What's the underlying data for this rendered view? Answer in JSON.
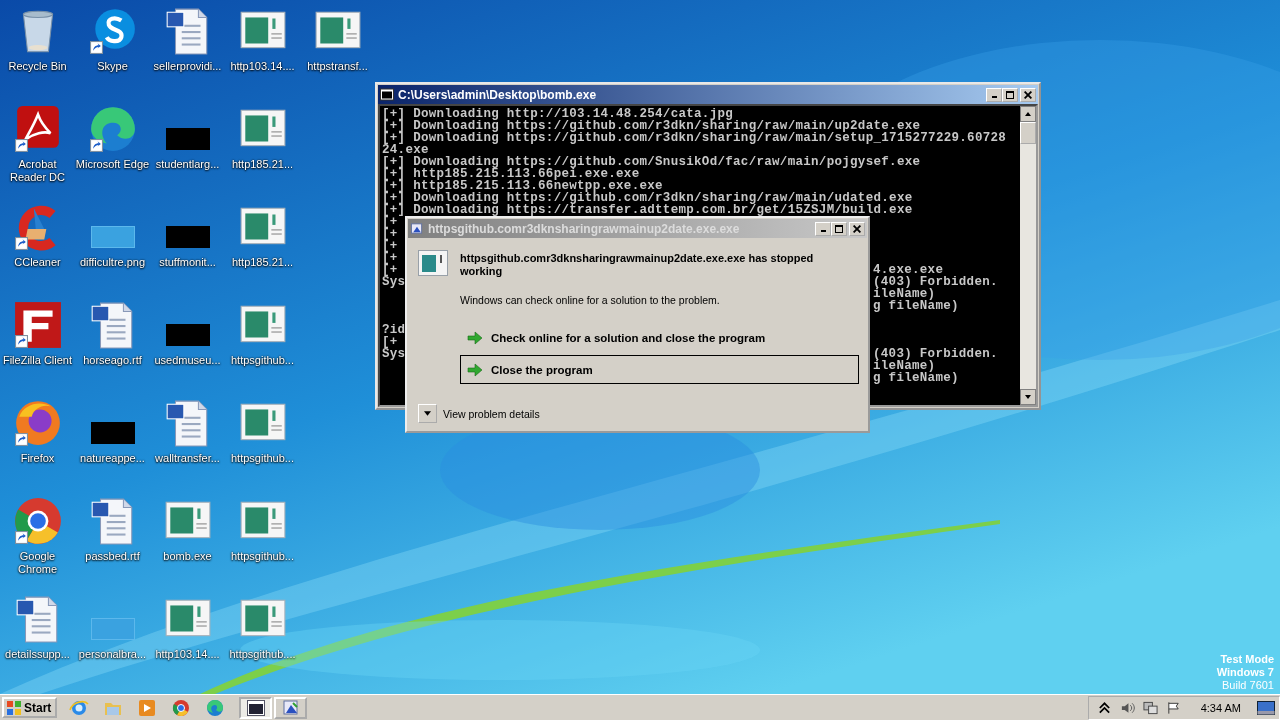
{
  "desktop": {
    "icons": [
      {
        "label": "Recycle Bin",
        "kind": "recycle",
        "shortcut": false
      },
      {
        "label": "Acrobat Reader DC",
        "kind": "acrobat",
        "shortcut": true
      },
      {
        "label": "CCleaner",
        "kind": "ccleaner",
        "shortcut": true
      },
      {
        "label": "FileZilla Client",
        "kind": "filezilla",
        "shortcut": true
      },
      {
        "label": "Firefox",
        "kind": "firefox",
        "shortcut": true
      },
      {
        "label": "Google Chrome",
        "kind": "chrome",
        "shortcut": true
      },
      {
        "label": "detailssupp...",
        "kind": "word",
        "shortcut": false
      },
      {
        "label": "Skype",
        "kind": "skype",
        "shortcut": true
      },
      {
        "label": "Microsoft Edge",
        "kind": "edge",
        "shortcut": true
      },
      {
        "label": "difficultre.png",
        "kind": "blank",
        "shortcut": false
      },
      {
        "label": "horseago.rtf",
        "kind": "word",
        "shortcut": false
      },
      {
        "label": "natureappe...",
        "kind": "black",
        "shortcut": false
      },
      {
        "label": "passbed.rtf",
        "kind": "word",
        "shortcut": false
      },
      {
        "label": "personalbra...",
        "kind": "blank",
        "shortcut": false
      },
      {
        "label": "sellerprovidi...",
        "kind": "word",
        "shortcut": false
      },
      {
        "label": "studentlarg...",
        "kind": "black",
        "shortcut": false
      },
      {
        "label": "stuffmonit...",
        "kind": "black",
        "shortcut": false
      },
      {
        "label": "usedmuseu...",
        "kind": "black",
        "shortcut": false
      },
      {
        "label": "walltransfer...",
        "kind": "word",
        "shortcut": false
      },
      {
        "label": "bomb.exe",
        "kind": "exe",
        "shortcut": false
      },
      {
        "label": "http103.14....",
        "kind": "exe",
        "shortcut": false
      },
      {
        "label": "http103.14....",
        "kind": "exe",
        "shortcut": false
      },
      {
        "label": "http185.21...",
        "kind": "exe",
        "shortcut": false
      },
      {
        "label": "http185.21...",
        "kind": "exe",
        "shortcut": false
      },
      {
        "label": "httpsgithub...",
        "kind": "exe",
        "shortcut": false
      },
      {
        "label": "httpsgithub...",
        "kind": "exe",
        "shortcut": false
      },
      {
        "label": "httpsgithub...",
        "kind": "exe",
        "shortcut": false
      },
      {
        "label": "httpsgithub....",
        "kind": "exe",
        "shortcut": false
      },
      {
        "label": "httpstransf...",
        "kind": "exe",
        "shortcut": false
      }
    ]
  },
  "console": {
    "title": "C:\\Users\\admin\\Desktop\\bomb.exe",
    "lines": [
      {
        "text": "[+] Downloading http://103.14.48.254/cata.jpg"
      },
      {
        "text": "[+] Downloading https://github.com/r3dkn/sharing/raw/main/up2date.exe"
      },
      {
        "text": "[+] Downloading https://github.com/r3dkn/sharing/raw/main/setup_1715277229.60728"
      },
      {
        "text": "24.exe"
      },
      {
        "text": "[+] Downloading https://github.com/SnusikOd/fac/raw/main/pojgysef.exe"
      },
      {
        "text": "[+] http185.215.113.66pei.exe.exe"
      },
      {
        "text": "[+] http185.215.113.66newtpp.exe.exe"
      },
      {
        "text": "[+] Downloading https://github.com/r3dkn/sharing/raw/main/udated.exe"
      },
      {
        "text": "[+] Downloading https://transfer.adttemp.com.br/get/15ZSJM/build.exe"
      },
      {
        "text": "[+"
      },
      {
        "text": "[+"
      },
      {
        "text": "[+"
      },
      {
        "text": "[+"
      },
      {
        "text": "[+",
        "tail": "4.exe.exe"
      },
      {
        "text": "Sys",
        "tail": "(403) Forbidden."
      },
      {
        "tail": "ileName)"
      },
      {
        "tail": "g fileName)"
      },
      {
        "text": "?id",
        "blank_before": true
      },
      {
        "text": "[+"
      },
      {
        "text": "Sys",
        "tail": "(403) Forbidden."
      },
      {
        "tail": "ileName)"
      },
      {
        "tail": "g fileName)"
      }
    ]
  },
  "dialog": {
    "title": "httpsgithub.comr3dknsharingrawmainup2date.exe.exe",
    "heading": "httpsgithub.comr3dknsharingrawmainup2date.exe.exe has stopped working",
    "message": "Windows can check online for a solution to the problem.",
    "options": [
      {
        "label": "Check online for a solution and close the program",
        "selected": false
      },
      {
        "label": "Close the program",
        "selected": true
      }
    ],
    "details": "View problem details"
  },
  "notice": [
    {
      "text": "Test Mode",
      "bold": true
    },
    {
      "text": "Windows 7",
      "bold": true
    },
    {
      "text": "Build 7601",
      "bold": false
    }
  ],
  "taskbar": {
    "start": "Start",
    "quick_launch": [
      {
        "kind": "ie"
      },
      {
        "kind": "folder"
      },
      {
        "kind": "media"
      },
      {
        "kind": "chrome"
      },
      {
        "kind": "edge"
      }
    ],
    "tasks": [
      {
        "kind": "console",
        "selected": true
      },
      {
        "kind": "error",
        "selected": false
      }
    ],
    "clock": "4:34 AM"
  }
}
